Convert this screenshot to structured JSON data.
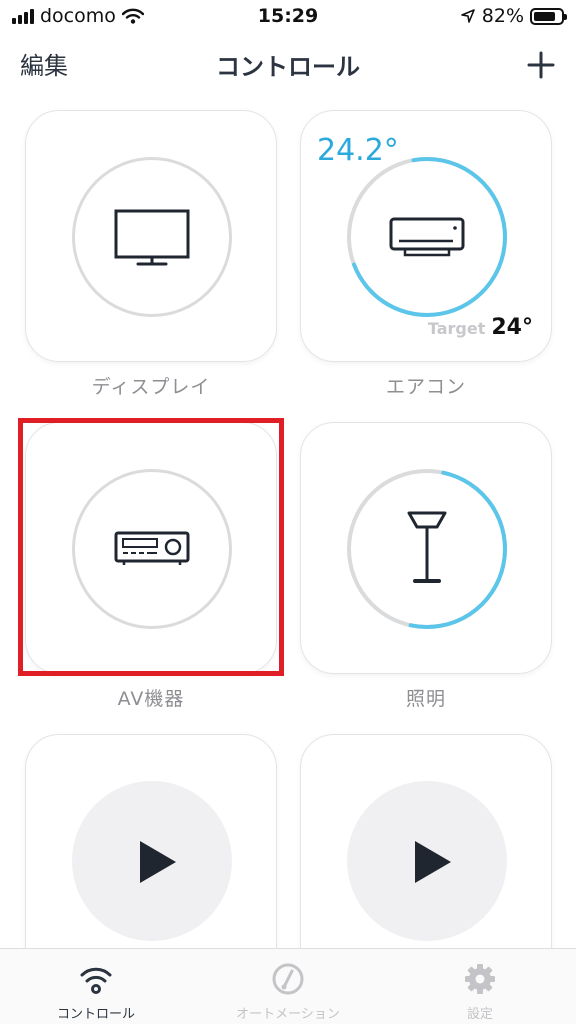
{
  "status_bar": {
    "carrier": "docomo",
    "time": "15:29",
    "battery_percent": "82%",
    "battery_level": 0.82
  },
  "nav": {
    "edit_label": "編集",
    "title": "コントロール",
    "add_icon": "plus-icon"
  },
  "tiles": [
    {
      "label": "ディスプレイ",
      "icon": "tv-icon"
    },
    {
      "label": "エアコン",
      "icon": "air-conditioner-icon",
      "current_temp": "24.2°",
      "target_label": "Target",
      "target_temp": "24°",
      "ring_fraction": 0.72
    },
    {
      "label": "AV機器",
      "icon": "av-receiver-icon",
      "selected": true
    },
    {
      "label": "照明",
      "icon": "floor-lamp-icon",
      "ring_fraction": 0.5
    },
    {
      "label": "",
      "icon": "play-icon"
    },
    {
      "label": "",
      "icon": "play-icon"
    }
  ],
  "tab_bar": {
    "tabs": [
      {
        "label": "コントロール",
        "icon": "wifi-icon",
        "active": true
      },
      {
        "label": "オートメーション",
        "icon": "speedometer-icon",
        "active": false
      },
      {
        "label": "設定",
        "icon": "gear-icon",
        "active": false
      }
    ]
  },
  "colors": {
    "accent": "#29a9dc",
    "ring_track": "#dadbdd",
    "highlight": "#e01e26",
    "tab_active": "#2b3440",
    "tab_inactive": "#c4c4c8"
  }
}
